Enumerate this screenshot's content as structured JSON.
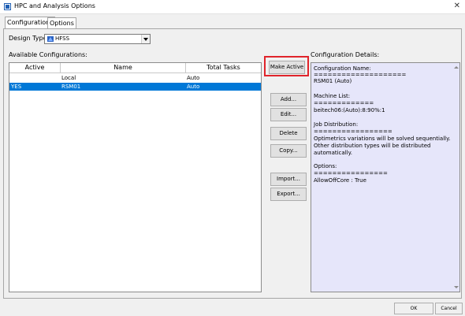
{
  "window": {
    "title": "HPC and Analysis Options"
  },
  "tabs": [
    {
      "label": "Configurations"
    },
    {
      "label": "Options"
    }
  ],
  "design_type": {
    "label": "Design Type:",
    "value": "HFSS"
  },
  "available": {
    "label": "Available Configurations:",
    "columns": [
      "Active",
      "Name",
      "Total Tasks"
    ],
    "rows": [
      {
        "active": "",
        "name": "Local",
        "tasks": "Auto"
      },
      {
        "active": "YES",
        "name": "RSM01",
        "tasks": "Auto"
      }
    ]
  },
  "buttons": {
    "make_active": "Make Active",
    "add": "Add...",
    "edit": "Edit...",
    "delete": "Delete",
    "copy": "Copy...",
    "import": "Import...",
    "export": "Export..."
  },
  "details": {
    "label": "Configuration Details:",
    "lines": [
      "Configuration Name:",
      "====================",
      "RSM01 (Auto)",
      "Machine List:",
      "=============",
      "beitech06:(Auto):8:90%:1",
      "Job Distribution:",
      "=================",
      "Optimetrics variations will be solved sequentially.",
      "Other distribution types will be distributed",
      "automatically.",
      "Options:",
      "================",
      "AllowOffCore : True"
    ]
  },
  "footer": {
    "ok": "OK",
    "cancel": "Cancel"
  }
}
